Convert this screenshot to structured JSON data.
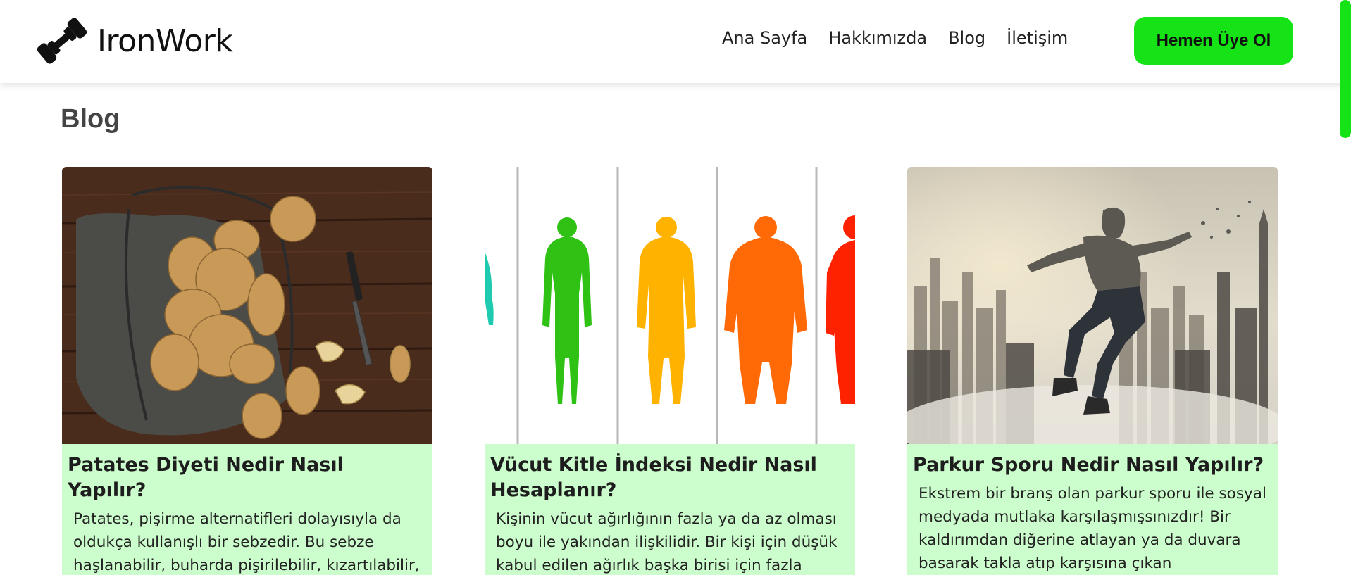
{
  "brand": {
    "name": "IronWork",
    "accent": "#16e316",
    "card_bg": "#ccfdcc"
  },
  "nav": {
    "links": [
      "Ana Sayfa",
      "Hakkımızda",
      "Blog",
      "İletişim"
    ],
    "cta_label": "Hemen Üye Ol"
  },
  "page": {
    "heading": "Blog"
  },
  "posts": [
    {
      "image": "potatoes-photo",
      "title": "Patates Diyeti Nedir Nasıl Yapılır?",
      "excerpt": "Patates, pişirme alternatifleri dolayısıyla da oldukça kullanışlı bir sebzedir. Bu sebze haşlanabilir, buharda pişirilebilir, kızartılabilir, fırınlanabilir veya kızartılabilir. Yapım türüne"
    },
    {
      "image": "body-mass-index-illustration",
      "title": "Vücut Kitle İndeksi Nedir Nasıl Hesaplanır?",
      "excerpt": "Kişinin vücut ağırlığının fazla ya da az olması boyu ile yakından ilişkilidir. Bir kişi için düşük kabul edilen ağırlık başka birisi için fazla"
    },
    {
      "image": "parkour-jump-photo",
      "title": "Parkur Sporu Nedir Nasıl Yapılır?",
      "excerpt": "Ekstrem bir branş olan parkur sporu ile sosyal medyada mutlaka karşılaşmışsınızdır! Bir kaldırımdan diğerine atlayan ya da duvara basarak takla atıp karşısına çıkan"
    }
  ]
}
